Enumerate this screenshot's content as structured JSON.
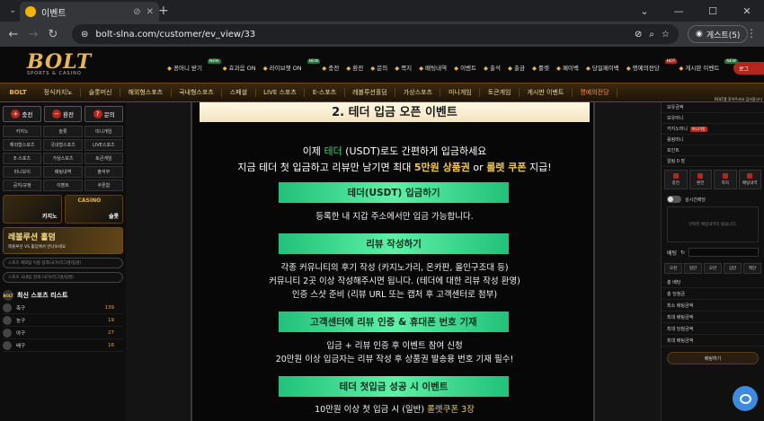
{
  "browser": {
    "tab_title": "이벤트",
    "url": "bolt-slna.com/customer/ev_view/33",
    "profile": "게스트(5)",
    "new_tab": "+",
    "win_min": "—",
    "win_max": "☐",
    "win_close": "✕"
  },
  "header": {
    "logo": "BOLT",
    "logo_sub": "SPORTS & CASINO",
    "top_menu": [
      {
        "label": "꽁머니 받기",
        "badge": "NEW"
      },
      {
        "label": "효과음 ON",
        "badge": ""
      },
      {
        "label": "라이브챗 ON",
        "badge": "NEW"
      },
      {
        "label": "충전",
        "badge": ""
      },
      {
        "label": "환전",
        "badge": ""
      },
      {
        "label": "문의",
        "badge": ""
      },
      {
        "label": "쪽지",
        "badge": ""
      },
      {
        "label": "배팅내역",
        "badge": ""
      },
      {
        "label": "이벤트",
        "badge": ""
      },
      {
        "label": "출석",
        "badge": ""
      },
      {
        "label": "출금",
        "badge": ""
      },
      {
        "label": "룰렛",
        "badge": ""
      },
      {
        "label": "페이백",
        "badge": ""
      },
      {
        "label": "당일페이백",
        "badge": ""
      },
      {
        "label": "명예의전당",
        "badge": "HOT"
      },
      {
        "label": "게시판 이벤트",
        "badge": "NEW"
      },
      {
        "label": "추천인 리스트",
        "badge": "NEW"
      }
    ],
    "login": "로그"
  },
  "catnav": {
    "small_logo": "BOLT",
    "items": [
      "정식카지노",
      "슬롯머신",
      "해외형스포츠",
      "국내형스포츠",
      "스페셜",
      "LIVE 스포츠",
      "E-스포츠",
      "레볼루션홀덤",
      "가상스포츠",
      "미니게임",
      "토큰게임",
      "게시판 이벤트",
      "명예의전당"
    ],
    "notice": "BOLT를 찾아주셔서 감사합니다"
  },
  "left": {
    "top_buttons": [
      {
        "icon": "+",
        "label": "충전"
      },
      {
        "icon": "−",
        "label": "환전"
      },
      {
        "icon": "?",
        "label": "문의"
      }
    ],
    "grid": [
      "카지노",
      "슬롯",
      "미니게임",
      "해외형스포츠",
      "국내형스포츠",
      "LIVE스포츠",
      "E-스포츠",
      "가상스포츠",
      "토큰게임",
      "미니보이",
      "배팅내역",
      "출석부",
      "공지/규정",
      "이벤트",
      "쿠폰함"
    ],
    "banners": [
      {
        "label": "카지노",
        "sign": ""
      },
      {
        "label": "슬롯",
        "sign": "CASINO"
      }
    ],
    "level_banner": {
      "title": "레볼루션 홀덤",
      "sub": "레볼루션 VS 홀덤에서 만나보세요"
    },
    "search1": "스포츠 해외팀 이름 입력(국가/리그명/팀명)",
    "search2": "스포츠 국내팀 검색 (국가/리그명/팀명)",
    "list_logo": "BOLT",
    "list_title": "최신 스포츠 리스트",
    "sports": [
      {
        "name": "축구",
        "count": "139"
      },
      {
        "name": "농구",
        "count": "19"
      },
      {
        "name": "야구",
        "count": "27"
      },
      {
        "name": "배구",
        "count": "16"
      }
    ]
  },
  "content": {
    "header_text": "2. 테더 입금 오픈 이벤트",
    "intro1_a": "이제 ",
    "intro1_b": "테더",
    "intro1_c": " (USDT)로도 간편하게 입금하세요",
    "intro2_a": "지금 테더 첫 입금하고 리뷰만 남기면 최대 ",
    "intro2_b": "5만원 상품권",
    "intro2_c": " or ",
    "intro2_d": "롤렛 쿠폰",
    "intro2_e": " 지급!",
    "btn1": "테더(USDT) 입금하기",
    "line1": "등록한 내 지갑 주소에서만 입금 가능합니다.",
    "btn2": "리뷰 작성하기",
    "line2": "각종 커뮤니티의 후기 작성 (카지노가리, 온카판, 올인구조대 등)",
    "line3": "커뮤니티 2곳 이상 작성해주시면 됩니다. (테더에 대한 리뷰 작성 환영)",
    "line4": "인증 스샷 준비 (리뷰 URL 또는 캡처 후 고객센터로 첨부)",
    "btn3": "고객센터에 리뷰 인증 & 휴대폰 번호 기재",
    "line5": "입금 + 리뷰 인증 후 이벤트 참여 신청",
    "line6": "20만원 이상 입금자는 리뷰 작성 후 상품권 발송용 번호 기재 필수!",
    "btn4": "테더 첫입금 성공 시 이벤트",
    "line7_a": "10만원 이상 첫 입금 시 (일반) ",
    "line7_b": "롤렛쿠폰 3장"
  },
  "right": {
    "rows": [
      {
        "label": "보유금액",
        "tag": ""
      },
      {
        "label": "보유머니",
        "tag": ""
      },
      {
        "label": "카지노머니",
        "tag": "머니이동"
      },
      {
        "label": "롤링머니",
        "tag": ""
      },
      {
        "label": "포인트",
        "tag": ""
      },
      {
        "label": "알림 0 장",
        "tag": ""
      }
    ],
    "buttons": [
      "충전",
      "환전",
      "쪽지",
      "배팅내역"
    ],
    "toggle_label": "실시간배당",
    "empty": "선택된 배팅내역이 없습니다.",
    "bet_label": "배팅",
    "refresh": "↻",
    "amounts": [
      "오천",
      "일만",
      "오만",
      "십만",
      "백만"
    ],
    "stats": [
      "총 배당",
      "총 당첨금",
      "최소 배팅금액",
      "최대 배팅금액",
      "최대 당첨금액",
      "최대 배팅금액"
    ],
    "bet_button": "배팅하기"
  }
}
